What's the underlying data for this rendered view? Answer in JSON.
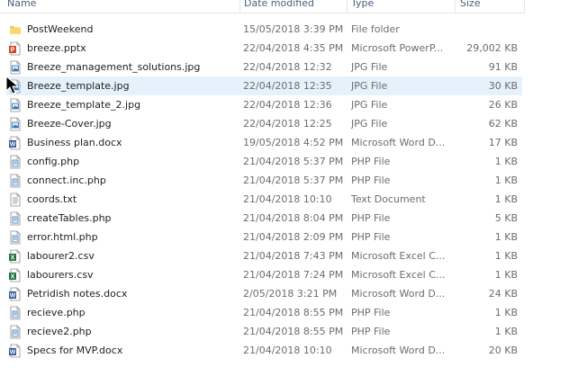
{
  "columns": {
    "name": "Name",
    "date": "Date modified",
    "type": "Type",
    "size": "Size"
  },
  "files": [
    {
      "name": "PostWeekend",
      "date": "15/05/2018 3:39 PM",
      "type": "File folder",
      "size": "",
      "icon": "folder-icon"
    },
    {
      "name": "breeze.pptx",
      "date": "22/04/2018 4:35 PM",
      "type": "Microsoft PowerP...",
      "size": "29,002 KB",
      "icon": "powerpoint-icon"
    },
    {
      "name": "Breeze_management_solutions.jpg",
      "date": "22/04/2018 12:32",
      "type": "JPG File",
      "size": "91 KB",
      "icon": "image-file-icon"
    },
    {
      "name": "Breeze_template.jpg",
      "date": "22/04/2018 12:35",
      "type": "JPG File",
      "size": "30 KB",
      "icon": "image-file-icon"
    },
    {
      "name": "Breeze_template_2.jpg",
      "date": "22/04/2018 12:36",
      "type": "JPG File",
      "size": "26 KB",
      "icon": "image-file-icon"
    },
    {
      "name": "Breeze-Cover.jpg",
      "date": "22/04/2018 12:25",
      "type": "JPG File",
      "size": "62 KB",
      "icon": "image-file-icon"
    },
    {
      "name": "Business plan.docx",
      "date": "19/05/2018 4:52 PM",
      "type": "Microsoft Word D...",
      "size": "17 KB",
      "icon": "word-icon"
    },
    {
      "name": "config.php",
      "date": "21/04/2018 5:37 PM",
      "type": "PHP File",
      "size": "1 KB",
      "icon": "php-file-icon"
    },
    {
      "name": "connect.inc.php",
      "date": "21/04/2018 5:37 PM",
      "type": "PHP File",
      "size": "1 KB",
      "icon": "php-file-icon"
    },
    {
      "name": "coords.txt",
      "date": "21/04/2018 10:10",
      "type": "Text Document",
      "size": "1 KB",
      "icon": "text-file-icon"
    },
    {
      "name": "createTables.php",
      "date": "21/04/2018 8:04 PM",
      "type": "PHP File",
      "size": "5 KB",
      "icon": "php-file-icon"
    },
    {
      "name": "error.html.php",
      "date": "21/04/2018 2:09 PM",
      "type": "PHP File",
      "size": "1 KB",
      "icon": "php-file-icon"
    },
    {
      "name": "labourer2.csv",
      "date": "21/04/2018 7:43 PM",
      "type": "Microsoft Excel C...",
      "size": "1 KB",
      "icon": "excel-icon"
    },
    {
      "name": "labourers.csv",
      "date": "21/04/2018 7:24 PM",
      "type": "Microsoft Excel C...",
      "size": "1 KB",
      "icon": "excel-icon"
    },
    {
      "name": "Petridish notes.docx",
      "date": "2/05/2018 3:21 PM",
      "type": "Microsoft Word D...",
      "size": "24 KB",
      "icon": "word-icon"
    },
    {
      "name": "recieve.php",
      "date": "21/04/2018 8:55 PM",
      "type": "PHP File",
      "size": "1 KB",
      "icon": "php-file-icon"
    },
    {
      "name": "recieve2.php",
      "date": "21/04/2018 8:55 PM",
      "type": "PHP File",
      "size": "1 KB",
      "icon": "php-file-icon"
    },
    {
      "name": "Specs for MVP.docx",
      "date": "21/04/2018 10:10",
      "type": "Microsoft Word D...",
      "size": "20 KB",
      "icon": "word-icon"
    }
  ],
  "selected_index": 3,
  "colors": {
    "header_text": "#4c607a",
    "selection": "#e5f1fb",
    "folder": "#f5c451",
    "word": "#2b579a",
    "excel": "#217346",
    "powerpoint": "#d24726"
  }
}
